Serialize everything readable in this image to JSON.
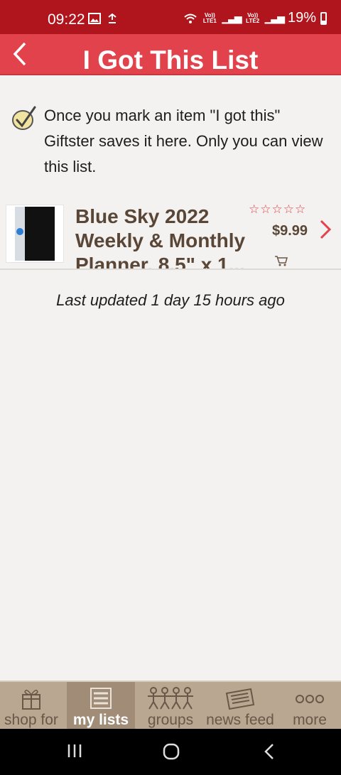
{
  "status_bar": {
    "time": "09:22",
    "sim1": "Vo)) LTE1",
    "sim2": "Vo)) LTE2",
    "battery": "19%"
  },
  "header": {
    "title": "I Got This List"
  },
  "info": {
    "text": "Once you mark an item \"I got this\" Giftster saves it here. Only you can view this list."
  },
  "items": [
    {
      "title": "Blue Sky 2022 Weekly & Monthly Planner, 8.5\" x 1...",
      "rating": "☆☆☆☆☆",
      "price": "$9.99"
    }
  ],
  "last_updated": "Last updated 1 day 15 hours ago",
  "tabs": [
    {
      "label": "shop for"
    },
    {
      "label": "my lists",
      "active": true
    },
    {
      "label": "groups"
    },
    {
      "label": "news feed"
    },
    {
      "label": "more"
    }
  ],
  "colors": {
    "status_bar": "#b0151e",
    "header": "#e2424b",
    "tabbar": "#b9a792",
    "accent": "#e2424b"
  }
}
